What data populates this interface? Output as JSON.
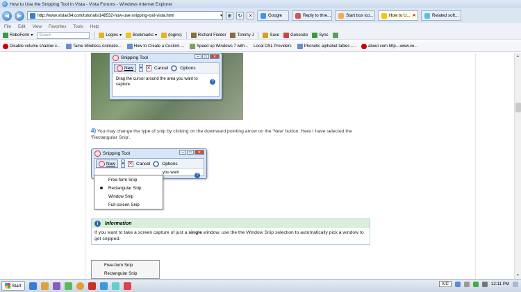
{
  "window": {
    "title": "How to Use the Snipping Tool in Vista - Vista Forums - Windows Internet Explorer"
  },
  "address": {
    "url": "http://www.vistax64.com/tutorials/148532-how-use-snipping-tool-vista.html"
  },
  "tabs": [
    {
      "label": "Google",
      "color": "#4a90e2"
    },
    {
      "label": "Reply to thre...",
      "color": "#d9534f"
    },
    {
      "label": "Start box ico...",
      "color": "#f0ad4e"
    },
    {
      "label": "How to U...",
      "color": "#f0c419"
    },
    {
      "label": "Related soft...",
      "color": "#5bc0de"
    }
  ],
  "menu": {
    "items": [
      "File",
      "Edit",
      "View",
      "Favorites",
      "Tools",
      "Help"
    ]
  },
  "toolbar": {
    "roboform": "RoboForm",
    "search_placeholder": "Search",
    "logins": "Logins",
    "bookmarks": "Bookmarks",
    "logins_paren": "(logins)",
    "richard": "Richard Fielder",
    "tommy": "Tommy J",
    "save": "Save",
    "generate": "Generate",
    "sync": "Sync"
  },
  "favorites": [
    "Disable volume shadow c...",
    "Tame Mindless Animatio...",
    "How to Create a Custom ...",
    "Speed up Windows 7 with...",
    "Local DSL Providers",
    "Phonetic alphabet tables -...",
    "about.com http---www.ve..."
  ],
  "snip1": {
    "title": "Snipping Tool",
    "new": "New",
    "cancel": "Cancel",
    "options": "Options",
    "message": "Drag the cursor around the area you want to capture."
  },
  "step4": {
    "number": "4)",
    "text": "You may change the type of snip by clicking on the downward pointing arrow on the 'New' button. Here I have selected the 'Rectangular Snip'."
  },
  "snip2": {
    "title": "Snipping Tool",
    "new": "New",
    "cancel": "Cancel",
    "options": "Options",
    "message_tail": "you want"
  },
  "dropdown": {
    "options": [
      "Free-form Snip",
      "Rectangular Snip",
      "Window Snip",
      "Full-screen Snip"
    ]
  },
  "info": {
    "heading": "Information",
    "text_before": "If you want to take a screen capture of just a",
    "text_bold": "single",
    "text_after": "window, use the the Window Snip selection to automatically pick a window to get snipped."
  },
  "menu2": {
    "options": [
      "Free-form Snip",
      "Rectangular Snip"
    ]
  },
  "taskbar": {
    "start": "Start",
    "ac": "A/C",
    "clock": "12:11 PM"
  }
}
